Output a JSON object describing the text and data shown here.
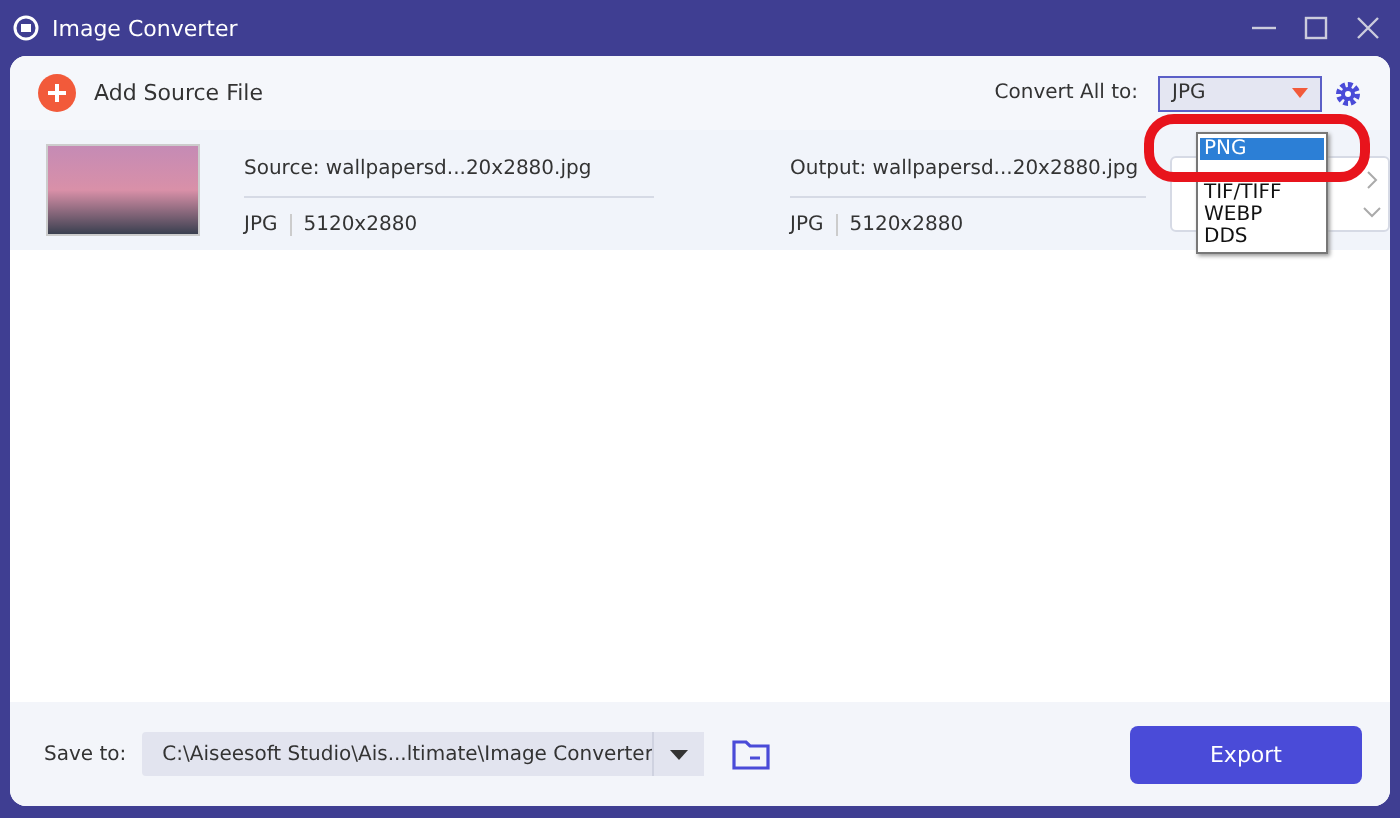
{
  "window": {
    "title": "Image Converter"
  },
  "toolbar": {
    "add_label": "Add Source File",
    "convert_label": "Convert All to:",
    "format": "JPG"
  },
  "format_menu": [
    {
      "label": "PNG",
      "selected": true
    },
    {
      "label": "TIF/TIFF",
      "selected": false
    },
    {
      "label": "WEBP",
      "selected": false
    },
    {
      "label": "DDS",
      "selected": false
    }
  ],
  "files": [
    {
      "source": "Source: wallpapersd...20x2880.jpg",
      "source_format": "JPG",
      "source_size": "5120x2880",
      "output": "Output: wallpapersd...20x2880.jpg",
      "output_format": "JPG",
      "output_size": "5120x2880"
    }
  ],
  "footer": {
    "save_label": "Save to:",
    "path": "C:\\Aiseesoft Studio\\Ais...ltimate\\Image Converter",
    "export": "Export"
  }
}
